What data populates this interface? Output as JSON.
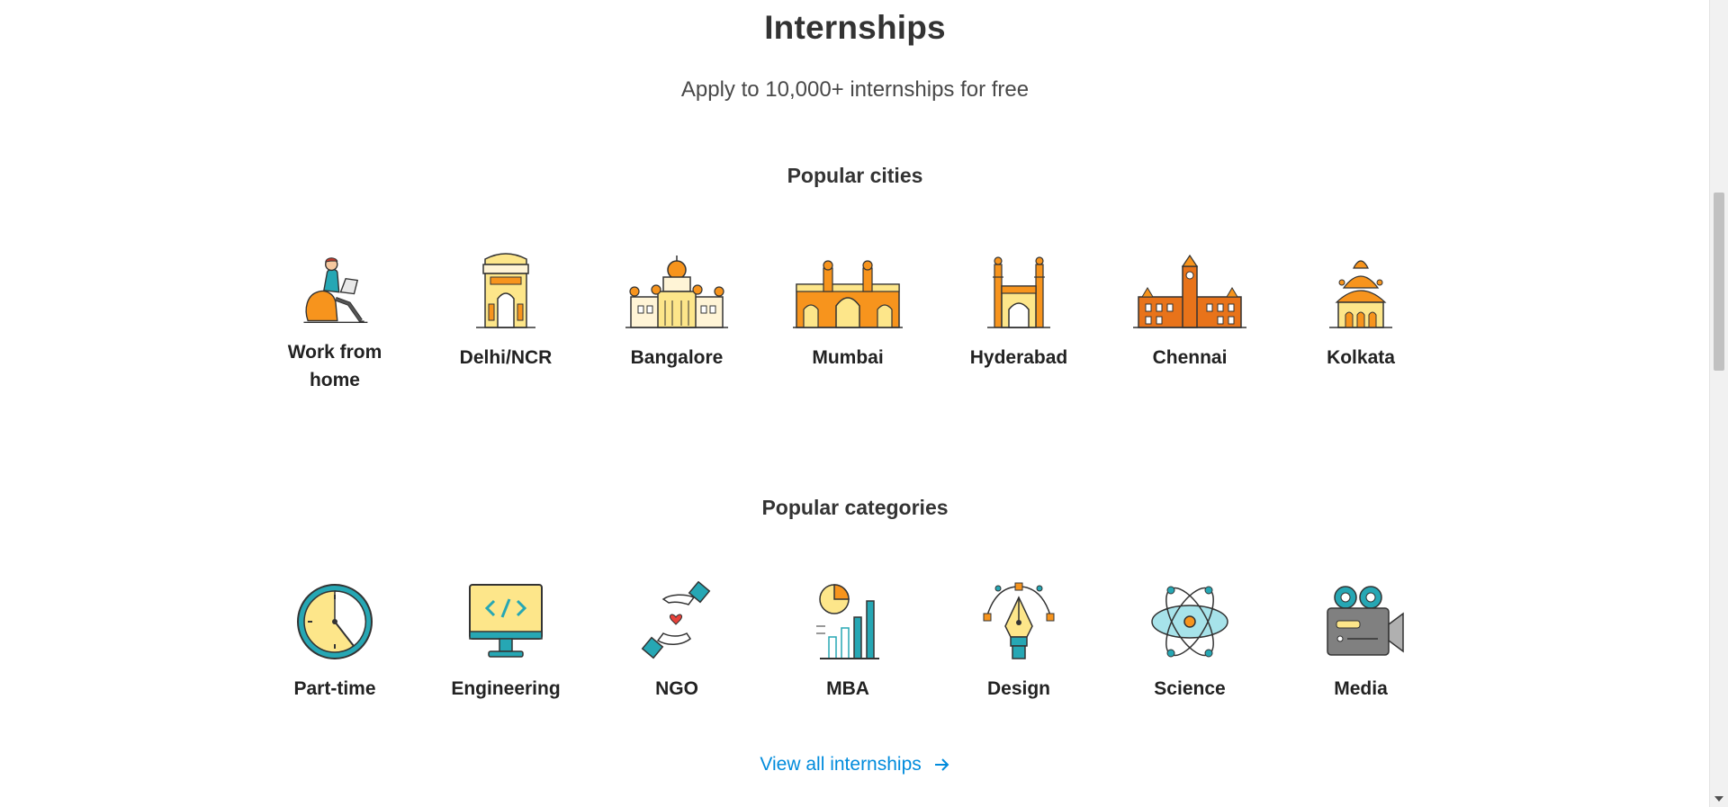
{
  "header": {
    "title": "Internships",
    "subtitle": "Apply to 10,000+ internships for free"
  },
  "cities": {
    "title": "Popular cities",
    "items": [
      {
        "label": "Work from home",
        "icon": "work-from-home-icon"
      },
      {
        "label": "Delhi/NCR",
        "icon": "india-gate-icon"
      },
      {
        "label": "Bangalore",
        "icon": "vidhana-soudha-icon"
      },
      {
        "label": "Mumbai",
        "icon": "gateway-of-india-icon"
      },
      {
        "label": "Hyderabad",
        "icon": "charminar-icon"
      },
      {
        "label": "Chennai",
        "icon": "chennai-central-icon"
      },
      {
        "label": "Kolkata",
        "icon": "dakshineswar-temple-icon"
      }
    ]
  },
  "categories": {
    "title": "Popular categories",
    "items": [
      {
        "label": "Part-time",
        "icon": "clock-icon"
      },
      {
        "label": "Engineering",
        "icon": "code-monitor-icon"
      },
      {
        "label": "NGO",
        "icon": "helping-hands-icon"
      },
      {
        "label": "MBA",
        "icon": "bar-chart-icon"
      },
      {
        "label": "Design",
        "icon": "pen-tool-icon"
      },
      {
        "label": "Science",
        "icon": "atom-icon"
      },
      {
        "label": "Media",
        "icon": "video-camera-icon"
      }
    ]
  },
  "footer": {
    "view_all_label": "View all internships"
  },
  "colors": {
    "accent_link": "#008bdc",
    "icon_orange": "#f7941d",
    "icon_teal": "#26a7b4",
    "icon_yellow": "#fde68a",
    "icon_dark": "#333333"
  }
}
